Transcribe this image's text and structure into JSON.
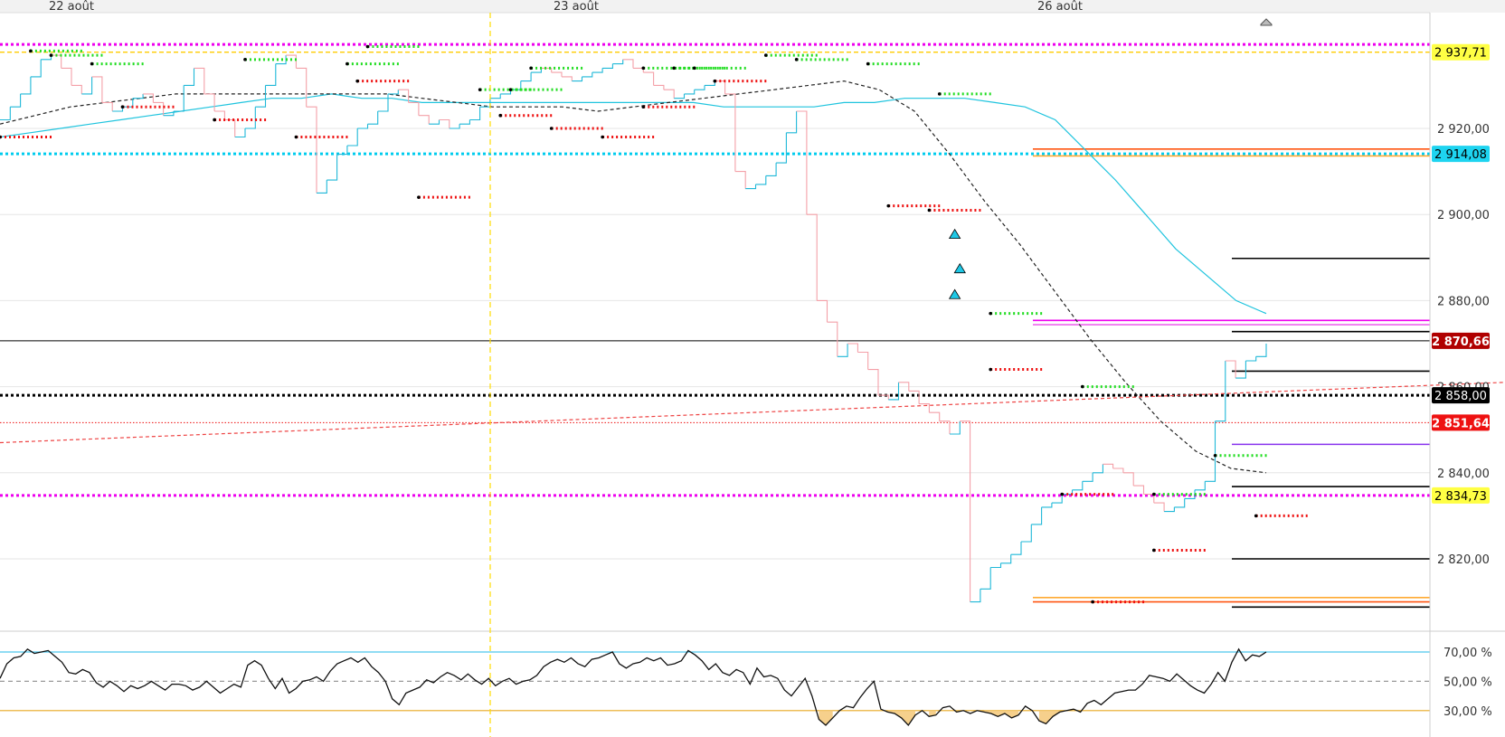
{
  "chart_data": [
    {
      "type": "line",
      "panel": "price",
      "x_labels": [
        "22 août",
        "23 août",
        "26 août"
      ],
      "y_axis": {
        "ylim": [
          2810,
          2960
        ],
        "ticks": [
          {
            "value": 2920,
            "label": "2 920,00"
          },
          {
            "value": 2900,
            "label": "2 900,00"
          },
          {
            "value": 2880,
            "label": "2 880,00"
          },
          {
            "value": 2860,
            "label": "2 860,00"
          },
          {
            "value": 2840,
            "label": "2 840,00"
          },
          {
            "value": 2820,
            "label": "2 820,00"
          }
        ]
      },
      "price_tags": [
        {
          "value": 2937.71,
          "label": "2 937,71",
          "bg": "#ffff44",
          "fg": "#000000"
        },
        {
          "value": 2914.08,
          "label": "2 914,08",
          "bg": "#1ed4f0",
          "fg": "#000000"
        },
        {
          "value": 2870.66,
          "label": "2 870,66",
          "bg": "#b00000",
          "fg": "#ffffff"
        },
        {
          "value": 2858.0,
          "label": "2 858,00",
          "bg": "#000000",
          "fg": "#ffffff"
        },
        {
          "value": 2851.64,
          "label": "2 851,64",
          "bg": "#ee1111",
          "fg": "#ffffff"
        },
        {
          "value": 2834.73,
          "label": "2 834,73",
          "bg": "#ffff44",
          "fg": "#000000"
        }
      ],
      "horizontal_levels": [
        {
          "value": 2939.5,
          "color": "#ee00ee",
          "style": "dotted-thick"
        },
        {
          "value": 2937.71,
          "color": "#ffcc00",
          "style": "dashed"
        },
        {
          "value": 2914.08,
          "color": "#00ccee",
          "style": "dotted-thick"
        },
        {
          "value": 2870.66,
          "color": "#000000",
          "style": "solid-thin"
        },
        {
          "value": 2858.0,
          "color": "#000000",
          "style": "dotted-thick"
        },
        {
          "value": 2851.64,
          "color": "#ee1111",
          "style": "dotted-thin"
        },
        {
          "value": 2834.73,
          "color": "#ee00ee",
          "style": "dotted-thick"
        }
      ],
      "close_series": [
        2922,
        2925,
        2928,
        2932,
        2936,
        2937,
        2934,
        2930,
        2928,
        2932,
        2926,
        2924,
        2925,
        2927,
        2928,
        2926,
        2923,
        2924,
        2930,
        2934,
        2928,
        2924,
        2922,
        2918,
        2920,
        2925,
        2930,
        2935,
        2937,
        2934,
        2925,
        2905,
        2908,
        2914,
        2916,
        2920,
        2921,
        2924,
        2928,
        2929,
        2926,
        2923,
        2921,
        2922,
        2920,
        2921,
        2922,
        2925,
        2927,
        2928,
        2929,
        2931,
        2933,
        2934,
        2933,
        2932,
        2931,
        2932,
        2933,
        2934,
        2935,
        2936,
        2934,
        2933,
        2930,
        2929,
        2927,
        2928,
        2929,
        2930,
        2931,
        2928,
        2910,
        2906,
        2907,
        2909,
        2912,
        2919,
        2924,
        2900,
        2880,
        2875,
        2867,
        2870,
        2868,
        2864,
        2858,
        2857,
        2861,
        2859,
        2856,
        2854,
        2852,
        2849,
        2852,
        2810,
        2813,
        2818,
        2819,
        2821,
        2824,
        2828,
        2832,
        2833,
        2835,
        2836,
        2838,
        2840,
        2842,
        2841,
        2840,
        2837,
        2835,
        2833,
        2831,
        2832,
        2834,
        2836,
        2838,
        2852,
        2866,
        2862,
        2866,
        2867,
        2870
      ],
      "xlim": [
        0,
        124
      ],
      "series": [
        {
          "name": "",
          "color": "#1fc4de",
          "style": "solid",
          "values": [
            2918,
            2919,
            2920,
            2921,
            2922,
            2923,
            2924,
            2925,
            2926,
            2927,
            2927,
            2928,
            2927,
            2927,
            2926,
            2926,
            2926,
            2926,
            2926,
            2926,
            2926,
            2926,
            2926,
            2926,
            2925,
            2925,
            2925,
            2925,
            2926,
            2926,
            2927,
            2927,
            2927,
            2926,
            2925,
            2922,
            2915,
            2908,
            2900,
            2892,
            2886,
            2880,
            2877
          ]
        },
        {
          "name": "",
          "color": "#222222",
          "style": "dashed",
          "values": [
            2921,
            2923,
            2925,
            2926,
            2927,
            2928,
            2928,
            2928,
            2928,
            2928,
            2928,
            2928,
            2927,
            2926,
            2925,
            2925,
            2925,
            2924,
            2925,
            2926,
            2927,
            2928,
            2929,
            2930,
            2931,
            2929,
            2924,
            2914,
            2903,
            2893,
            2882,
            2871,
            2861,
            2852,
            2845,
            2841,
            2840
          ]
        },
        {
          "name": "",
          "color": "#ee4444",
          "style": "dashed",
          "values": [
            2847,
            2861
          ]
        }
      ],
      "resistance_marks": [
        {
          "x": 3,
          "value": 2938
        },
        {
          "x": 5,
          "value": 2937
        },
        {
          "x": 9,
          "value": 2935
        },
        {
          "x": 24,
          "value": 2936
        },
        {
          "x": 34,
          "value": 2935
        },
        {
          "x": 36,
          "value": 2939
        },
        {
          "x": 47,
          "value": 2929
        },
        {
          "x": 50,
          "value": 2929
        },
        {
          "x": 52,
          "value": 2934
        },
        {
          "x": 63,
          "value": 2934
        },
        {
          "x": 66,
          "value": 2934
        },
        {
          "x": 68,
          "value": 2934
        },
        {
          "x": 75,
          "value": 2937
        },
        {
          "x": 78,
          "value": 2936
        },
        {
          "x": 85,
          "value": 2935
        },
        {
          "x": 92,
          "value": 2928
        },
        {
          "x": 97,
          "value": 2877
        },
        {
          "x": 106,
          "value": 2860
        },
        {
          "x": 113,
          "value": 2835
        },
        {
          "x": 119,
          "value": 2844
        }
      ],
      "support_marks": [
        {
          "x": 0,
          "value": 2918
        },
        {
          "x": 12,
          "value": 2925
        },
        {
          "x": 21,
          "value": 2922
        },
        {
          "x": 29,
          "value": 2918
        },
        {
          "x": 35,
          "value": 2931
        },
        {
          "x": 41,
          "value": 2904
        },
        {
          "x": 49,
          "value": 2923
        },
        {
          "x": 54,
          "value": 2920
        },
        {
          "x": 59,
          "value": 2918
        },
        {
          "x": 63,
          "value": 2925
        },
        {
          "x": 70,
          "value": 2931
        },
        {
          "x": 87,
          "value": 2902
        },
        {
          "x": 91,
          "value": 2901
        },
        {
          "x": 97,
          "value": 2864
        },
        {
          "x": 104,
          "value": 2835
        },
        {
          "x": 107,
          "value": 2810
        },
        {
          "x": 113,
          "value": 2822
        },
        {
          "x": 123,
          "value": 2830
        }
      ],
      "markers": [
        {
          "x": 93.5,
          "value": 2895.5,
          "shape": "triangle-up",
          "color": "#1ec8e6"
        },
        {
          "x": 94.0,
          "value": 2887.5,
          "shape": "triangle-up",
          "color": "#1ec8e6"
        },
        {
          "x": 93.5,
          "value": 2881.5,
          "shape": "triangle-up",
          "color": "#1ec8e6"
        }
      ],
      "right_levels": [
        {
          "value": 2915.2,
          "color": "#ff5511"
        },
        {
          "value": 2913.6,
          "color": "#ffaa33"
        },
        {
          "value": 2889.8,
          "color": "#000000"
        },
        {
          "value": 2875.4,
          "color": "#ee00ee"
        },
        {
          "value": 2874.4,
          "color": "#ee66ee"
        },
        {
          "value": 2872.8,
          "color": "#000000"
        },
        {
          "value": 2863.6,
          "color": "#000000"
        },
        {
          "value": 2846.6,
          "color": "#8833ee"
        },
        {
          "value": 2836.8,
          "color": "#000000"
        },
        {
          "value": 2820.0,
          "color": "#000000"
        },
        {
          "value": 2811.0,
          "color": "#ffaa33"
        },
        {
          "value": 2810.0,
          "color": "#ff5511"
        },
        {
          "value": 2808.8,
          "color": "#000000"
        }
      ]
    },
    {
      "type": "line",
      "panel": "oscillator",
      "ylim": [
        10,
        80
      ],
      "y_ticks": [
        {
          "value": 70,
          "label": "70,00 %"
        },
        {
          "value": 50,
          "label": "50,00 %"
        },
        {
          "value": 30,
          "label": "30,00 %"
        }
      ],
      "bands": [
        {
          "value": 70,
          "color": "#4ec8ee",
          "style": "solid"
        },
        {
          "value": 50,
          "color": "#999999",
          "style": "dashed"
        },
        {
          "value": 30,
          "color": "#e8a820",
          "style": "solid"
        }
      ],
      "series": [
        {
          "name": "",
          "color": "#111111",
          "values": [
            52,
            62,
            66,
            67,
            72,
            69,
            70,
            71,
            67,
            63,
            56,
            55,
            58,
            56,
            49,
            46,
            50,
            47,
            43,
            47,
            45,
            47,
            50,
            47,
            44,
            48,
            48,
            47,
            44,
            46,
            50,
            46,
            42,
            45,
            48,
            46,
            61,
            64,
            61,
            52,
            45,
            52,
            42,
            45,
            50,
            51,
            53,
            50,
            57,
            62,
            64,
            66,
            63,
            66,
            60,
            56,
            50,
            38,
            34,
            42,
            44,
            46,
            51,
            49,
            53,
            56,
            54,
            51,
            55,
            51,
            48,
            52,
            47,
            50,
            52,
            48,
            50,
            51,
            54,
            60,
            63,
            65,
            63,
            66,
            62,
            60,
            65,
            66,
            68,
            70,
            62,
            59,
            62,
            63,
            66,
            64,
            66,
            61,
            62,
            64,
            71,
            68,
            64,
            58,
            62,
            56,
            54,
            58,
            56,
            48,
            59,
            53,
            54,
            52,
            44,
            40,
            46,
            52,
            40,
            24,
            20,
            25,
            30,
            33,
            32,
            39,
            45,
            50,
            31,
            29,
            28,
            25,
            20,
            27,
            30,
            26,
            27,
            32,
            33,
            29,
            30,
            28,
            30,
            29,
            28,
            26,
            28,
            25,
            27,
            33,
            30,
            23,
            21,
            26,
            29,
            30,
            31,
            29,
            35,
            37,
            34,
            38,
            42,
            43,
            44,
            44,
            48,
            54,
            53,
            52,
            50,
            55,
            51,
            47,
            44,
            42,
            48,
            56,
            50,
            63,
            72,
            64,
            68,
            67,
            70
          ]
        }
      ]
    }
  ]
}
